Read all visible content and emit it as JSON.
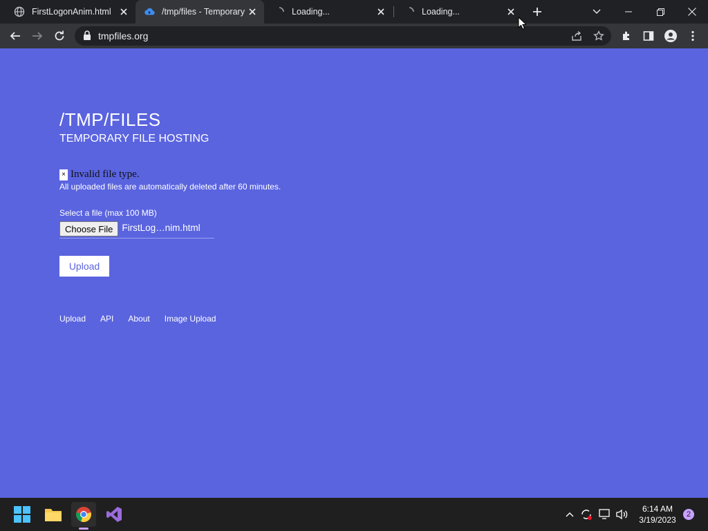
{
  "browser": {
    "tabs": [
      {
        "title": "FirstLogonAnim.html",
        "icon": "globe-icon"
      },
      {
        "title": "/tmp/files - Temporary",
        "icon": "cloud-upload-icon"
      },
      {
        "title": "Loading...",
        "icon": "spinner-icon"
      },
      {
        "title": "Loading...",
        "icon": "spinner-icon"
      }
    ],
    "url": "tmpfiles.org"
  },
  "page": {
    "title": "/TMP/FILES",
    "subtitle": "TEMPORARY FILE HOSTING",
    "error_close": "×",
    "error": "Invalid file type.",
    "notice": "All uploaded files are automatically deleted after 60 minutes.",
    "file_label": "Select a file (max 100 MB)",
    "choose_file": "Choose File",
    "chosen_file": "FirstLog…nim.html",
    "upload_button": "Upload",
    "nav": [
      "Upload",
      "API",
      "About",
      "Image Upload"
    ]
  },
  "taskbar": {
    "time": "6:14 AM",
    "date": "3/19/2023",
    "notifications": "2"
  },
  "colors": {
    "page_bg": "#5a64df",
    "chrome_dark": "#202124",
    "chrome_toolbar": "#35363a",
    "taskbar": "#1f1f1f"
  }
}
